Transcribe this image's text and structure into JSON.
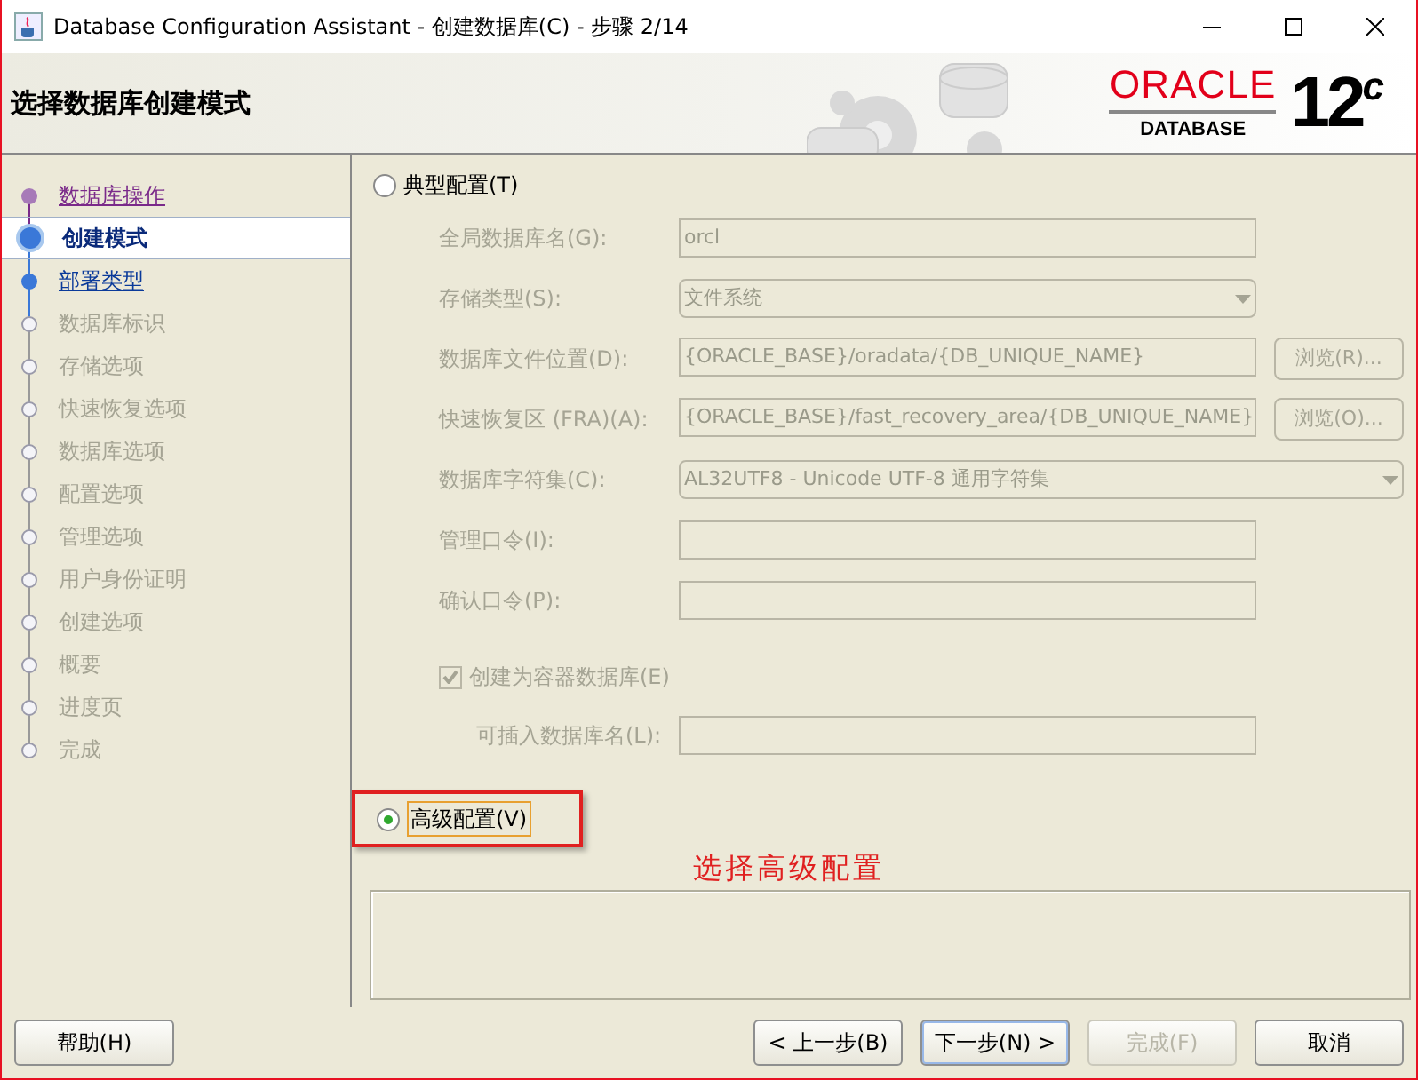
{
  "window": {
    "title": "Database Configuration Assistant - 创建数据库(C) - 步骤 2/14"
  },
  "header": {
    "title": "选择数据库创建模式",
    "logo": {
      "brand": "ORACLE",
      "product": "DATABASE",
      "version": "12",
      "suffix": "c"
    }
  },
  "steps": [
    {
      "label": "数据库操作",
      "visited": true,
      "selected": false,
      "disabled": false
    },
    {
      "label": "创建模式",
      "visited": false,
      "selected": true,
      "disabled": false
    },
    {
      "label": "部署类型",
      "visited": false,
      "selected": false,
      "disabled": false
    },
    {
      "label": "数据库标识",
      "visited": false,
      "selected": false,
      "disabled": true
    },
    {
      "label": "存储选项",
      "visited": false,
      "selected": false,
      "disabled": true
    },
    {
      "label": "快速恢复选项",
      "visited": false,
      "selected": false,
      "disabled": true
    },
    {
      "label": "数据库选项",
      "visited": false,
      "selected": false,
      "disabled": true
    },
    {
      "label": "配置选项",
      "visited": false,
      "selected": false,
      "disabled": true
    },
    {
      "label": "管理选项",
      "visited": false,
      "selected": false,
      "disabled": true
    },
    {
      "label": "用户身份证明",
      "visited": false,
      "selected": false,
      "disabled": true
    },
    {
      "label": "创建选项",
      "visited": false,
      "selected": false,
      "disabled": true
    },
    {
      "label": "概要",
      "visited": false,
      "selected": false,
      "disabled": true
    },
    {
      "label": "进度页",
      "visited": false,
      "selected": false,
      "disabled": true
    },
    {
      "label": "完成",
      "visited": false,
      "selected": false,
      "disabled": true
    }
  ],
  "typical": {
    "label": "典型配置(T)",
    "selected": false,
    "fields": [
      {
        "kind": "text",
        "label": "全局数据库名(G):",
        "value": "orcl"
      },
      {
        "kind": "select",
        "label": "存储类型(S):",
        "value": "文件系统"
      },
      {
        "kind": "path",
        "label": "数据库文件位置(D):",
        "value": "{ORACLE_BASE}/oradata/{DB_UNIQUE_NAME}",
        "button": "浏览(R)..."
      },
      {
        "kind": "path",
        "label": "快速恢复区 (FRA)(A):",
        "value": "{ORACLE_BASE}/fast_recovery_area/{DB_UNIQUE_NAME}",
        "button": "浏览(O)..."
      },
      {
        "kind": "wideselect",
        "label": "数据库字符集(C):",
        "value": "AL32UTF8 - Unicode UTF-8 通用字符集"
      },
      {
        "kind": "text",
        "label": "管理口令(I):"
      },
      {
        "kind": "text",
        "label": "确认口令(P):"
      }
    ],
    "container": {
      "label": "创建为容器数据库(E)",
      "checked": true
    },
    "pluggable": {
      "label": "可插入数据库名(L):"
    }
  },
  "advanced": {
    "label": "高级配置(V)",
    "selected": true
  },
  "annotation": "选择高级配置",
  "buttons": [
    {
      "label": "帮助(H)",
      "disabled": false
    },
    {
      "label": "< 上一步(B)",
      "disabled": false
    },
    {
      "label": "下一步(N) >",
      "disabled": false,
      "default": true
    },
    {
      "label": "完成(F)",
      "disabled": true
    },
    {
      "label": "取消",
      "disabled": false
    }
  ]
}
